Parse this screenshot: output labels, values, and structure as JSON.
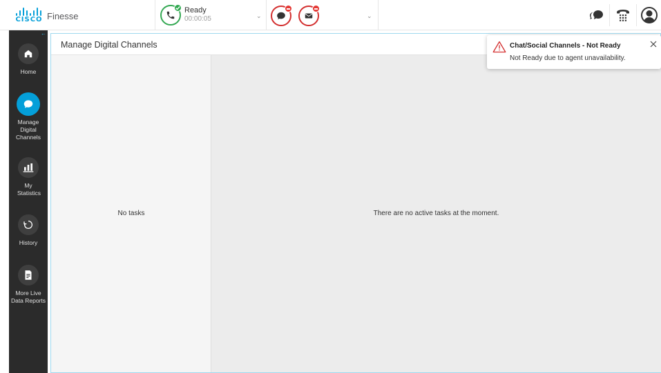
{
  "header": {
    "logo_text": "CISCO",
    "app_title": "Finesse",
    "voice": {
      "state_label": "Ready",
      "timer": "00:00:05",
      "icon": "phone-icon",
      "status_icon": "check-icon"
    },
    "digital": {
      "chat_icon": "chat-icon",
      "email_icon": "email-icon",
      "status_icon": "minus-icon"
    },
    "right_icons": [
      "chat-bubble-icon",
      "dialpad-icon",
      "avatar-icon"
    ]
  },
  "sidebar": {
    "items": [
      {
        "label": "Home",
        "icon": "home-icon",
        "active": false
      },
      {
        "label": "Manage Digital Channels",
        "icon": "chat-icon",
        "active": true
      },
      {
        "label": "My Statistics",
        "icon": "bar-chart-icon",
        "active": false
      },
      {
        "label": "History",
        "icon": "history-icon",
        "active": false
      },
      {
        "label": "More Live Data Reports",
        "icon": "report-icon",
        "active": false
      }
    ]
  },
  "main": {
    "title": "Manage Digital Channels",
    "task_list_empty": "No tasks",
    "detail_empty": "There are no active tasks at the moment."
  },
  "toast": {
    "title": "Chat/Social Channels - Not Ready",
    "message": "Not Ready due to agent unavailability.",
    "icon": "warning-icon"
  },
  "colors": {
    "accent": "#049fd9",
    "ready_green": "#34a853",
    "not_ready_red": "#d32f2f",
    "sidebar_bg": "#2b2b2b",
    "detail_bg": "#ececec"
  }
}
